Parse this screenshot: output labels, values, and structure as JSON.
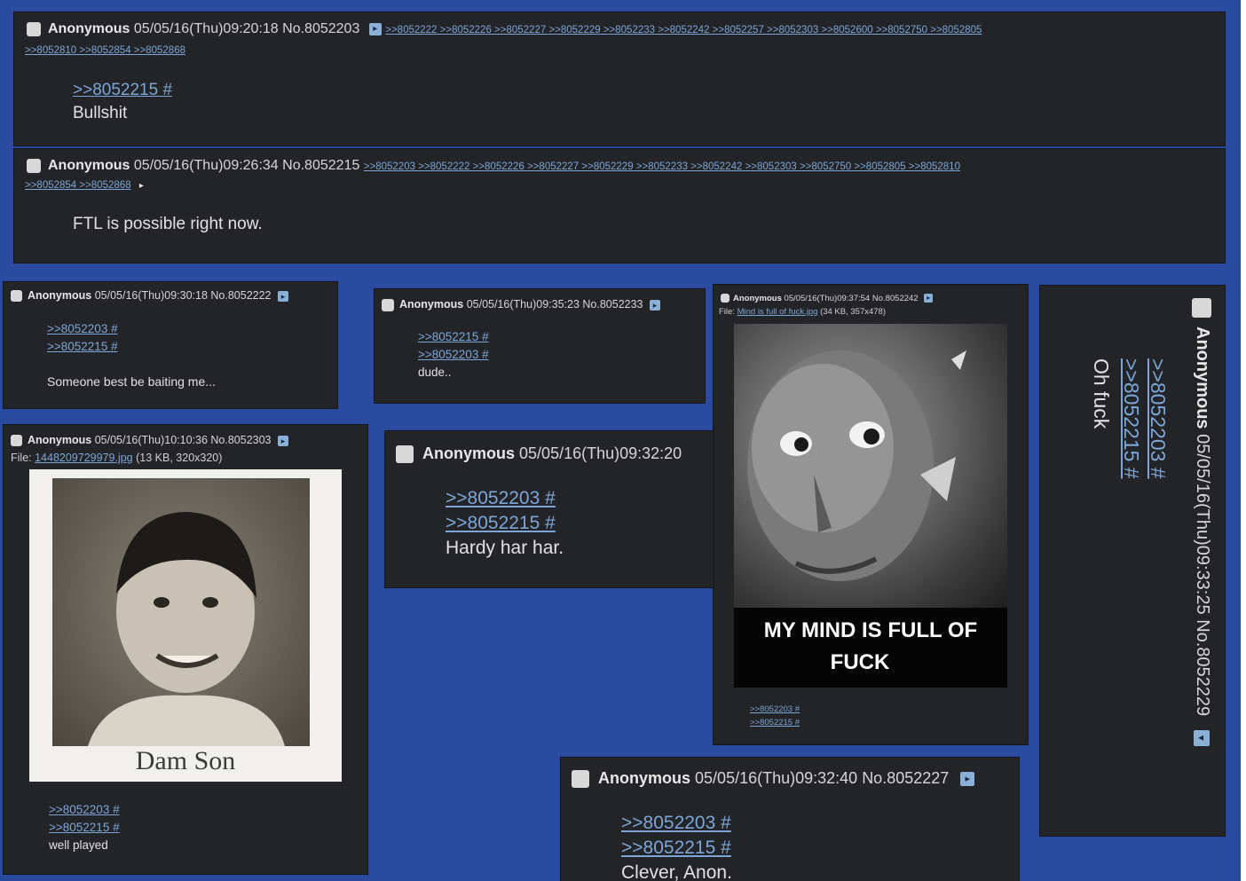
{
  "posts": {
    "p8052203": {
      "name": "Anonymous",
      "datetime": "05/05/16(Thu)09:20:18",
      "num": "No.8052203",
      "backlinks_line1": ">>8052222 >>8052226 >>8052227 >>8052229 >>8052233 >>8052242 >>8052257 >>8052303 >>8052600 >>8052750 >>8052805",
      "backlinks_line2": ">>8052810 >>8052854 >>8052868",
      "quote": ">>8052215 #",
      "text": "Bullshit"
    },
    "p8052215": {
      "name": "Anonymous",
      "datetime": "05/05/16(Thu)09:26:34",
      "num": "No.8052215",
      "backlinks_line1": ">>8052203 >>8052222 >>8052226 >>8052227 >>8052229 >>8052233 >>8052242 >>8052303 >>8052750 >>8052805 >>8052810",
      "backlinks_line2": ">>8052854 >>8052868",
      "text": "FTL is possible right now."
    },
    "p8052222": {
      "name": "Anonymous",
      "datetime": "05/05/16(Thu)09:30:18",
      "num": "No.8052222",
      "quote1": ">>8052203 #",
      "quote2": ">>8052215 #",
      "text": "Someone best be baiting me..."
    },
    "p8052233": {
      "name": "Anonymous",
      "datetime": "05/05/16(Thu)09:35:23",
      "num": "No.8052233",
      "quote1": ">>8052215 #",
      "quote2": ">>8052203 #",
      "text": "dude.."
    },
    "p8052242": {
      "name": "Anonymous",
      "datetime": "05/05/16(Thu)09:37:54",
      "num": "No.8052242",
      "file_label": "File:",
      "file_name": "Mind is full of fuck.jpg",
      "file_info": "(34 KB, 357x478)",
      "image_caption_line1": "MY MIND IS FULL OF",
      "image_caption_line2": "FUCK",
      "quote1": ">>8052203 #",
      "quote2": ">>8052215 #"
    },
    "p8052229": {
      "name": "Anonymous",
      "datetime": "05/05/16(Thu)09:33:25",
      "num": "No.8052229",
      "quote1": ">>8052203 #",
      "quote2": ">>8052215 #",
      "text": "Oh fuck"
    },
    "p8052303": {
      "name": "Anonymous",
      "datetime": "05/05/16(Thu)10:10:36",
      "num": "No.8052303",
      "file_label": "File:",
      "file_name": "1448209729979.jpg",
      "file_info": "(13 KB, 320x320)",
      "image_caption": "Dam Son",
      "quote1": ">>8052203 #",
      "quote2": ">>8052215 #",
      "text": "well played"
    },
    "p8052226": {
      "name": "Anonymous",
      "datetime": "05/05/16(Thu)09:32:20",
      "quote1": ">>8052203 #",
      "quote2": ">>8052215 #",
      "text": "Hardy har har."
    },
    "p8052227": {
      "name": "Anonymous",
      "datetime": "05/05/16(Thu)09:32:40",
      "num": "No.8052227",
      "quote1": ">>8052203 #",
      "quote2": ">>8052215 #",
      "text": "Clever, Anon."
    }
  },
  "icons": {
    "post_checkbox": "checkbox-icon",
    "post_menu": "post-menu-arrow-icon"
  },
  "colors": {
    "background": "#2a4aa0",
    "post_bg": "#222428",
    "link": "#7da6d6",
    "text": "#e2e2e2"
  }
}
